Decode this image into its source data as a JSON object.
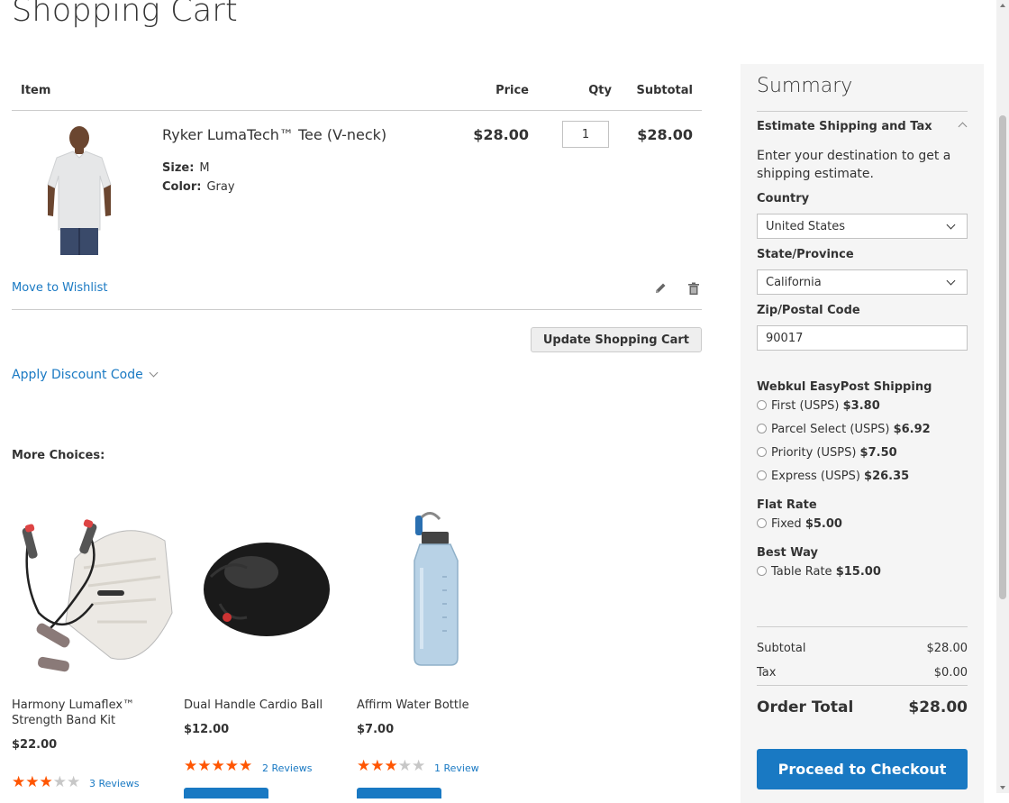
{
  "page": {
    "title": "Shopping Cart"
  },
  "cart": {
    "headers": {
      "item": "Item",
      "price": "Price",
      "qty": "Qty",
      "subtotal": "Subtotal"
    },
    "item": {
      "name": "Ryker LumaTech™ Tee (V-neck)",
      "options": [
        {
          "label": "Size:",
          "value": "M"
        },
        {
          "label": "Color:",
          "value": "Gray"
        }
      ],
      "price": "$28.00",
      "qty": "1",
      "subtotal": "$28.00",
      "move_to_wishlist": "Move to Wishlist",
      "edit_icon": "pencil-icon",
      "delete_icon": "trash-icon"
    },
    "update_button": "Update Shopping Cart",
    "discount_label": "Apply Discount Code"
  },
  "more_choices": {
    "title": "More Choices:",
    "products": [
      {
        "name": "Harmony Lumaflex™ Strength Band Kit",
        "price": "$22.00",
        "rating": 3,
        "reviews": "3 Reviews"
      },
      {
        "name": "Dual Handle Cardio Ball",
        "price": "$12.00",
        "rating": 5,
        "reviews": "2 Reviews"
      },
      {
        "name": "Affirm Water Bottle",
        "price": "$7.00",
        "rating": 3,
        "reviews": "1 Review"
      }
    ]
  },
  "summary": {
    "title": "Summary",
    "estimate_title": "Estimate Shipping and Tax",
    "estimate_text": "Enter your destination to get a shipping estimate.",
    "country_label": "Country",
    "country_value": "United States",
    "state_label": "State/Province",
    "state_value": "California",
    "zip_label": "Zip/Postal Code",
    "zip_value": "90017",
    "carriers": [
      {
        "name": "Webkul EasyPost Shipping",
        "rates": [
          {
            "label": "First (USPS)",
            "price": "$3.80"
          },
          {
            "label": "Parcel Select (USPS)",
            "price": "$6.92"
          },
          {
            "label": "Priority (USPS)",
            "price": "$7.50"
          },
          {
            "label": "Express (USPS)",
            "price": "$26.35"
          }
        ]
      },
      {
        "name": "Flat Rate",
        "rates": [
          {
            "label": "Fixed",
            "price": "$5.00"
          }
        ]
      },
      {
        "name": "Best Way",
        "rates": [
          {
            "label": "Table Rate",
            "price": "$15.00"
          }
        ]
      }
    ],
    "subtotal_label": "Subtotal",
    "subtotal_value": "$28.00",
    "tax_label": "Tax",
    "tax_value": "$0.00",
    "order_total_label": "Order Total",
    "order_total_value": "$28.00",
    "checkout_button": "Proceed to Checkout"
  },
  "colors": {
    "link": "#1979c3",
    "star": "#ff5501",
    "summary_bg": "#f5f5f5"
  }
}
